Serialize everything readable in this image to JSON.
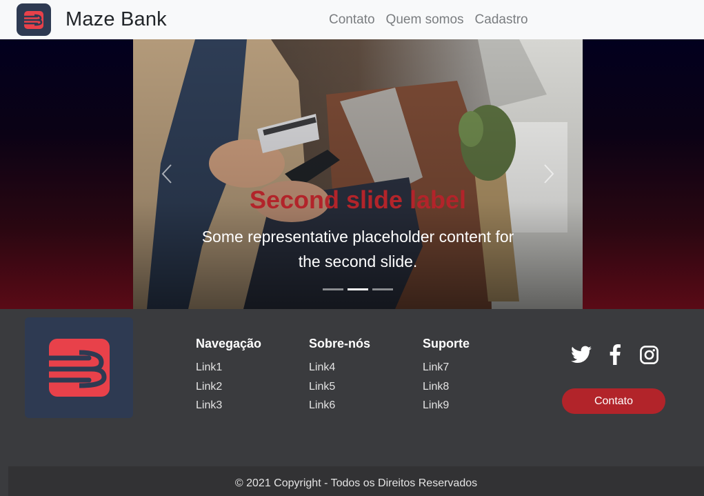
{
  "navbar": {
    "brand": "Maze Bank",
    "links": [
      "Contato",
      "Quem somos",
      "Cadastro"
    ]
  },
  "carousel": {
    "caption_title": "Second slide label",
    "caption_text": "Some representative placeholder content for the second slide.",
    "indicators_count": 3,
    "active_index": 1,
    "prev_icon": "chevron-left-icon",
    "next_icon": "chevron-right-icon"
  },
  "footer": {
    "columns": [
      {
        "title": "Navegação",
        "links": [
          "Link1",
          "Link2",
          "Link3"
        ]
      },
      {
        "title": "Sobre-nós",
        "links": [
          "Link4",
          "Link5",
          "Link6"
        ]
      },
      {
        "title": "Suporte",
        "links": [
          "Link7",
          "Link8",
          "Link9"
        ]
      }
    ],
    "social_icons": [
      "twitter-icon",
      "facebook-icon",
      "instagram-icon"
    ],
    "contact_button": "Contato",
    "copyright": "© 2021 Copyright - Todos os Direitos Reservados"
  },
  "colors": {
    "brand_red": "#b2242a",
    "logo_bg": "#2e3a52",
    "logo_red": "#e8414a",
    "footer_bg": "#3a3b3e"
  }
}
